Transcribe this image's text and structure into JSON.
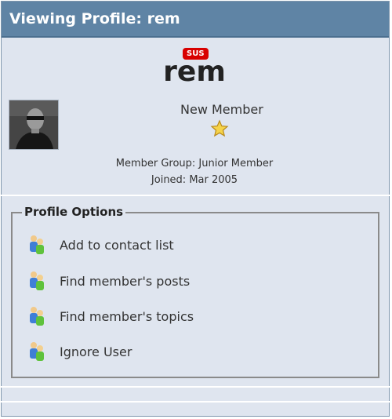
{
  "header": {
    "title": "Viewing Profile: rem"
  },
  "profile": {
    "badge": "SUS",
    "username": "rem",
    "rank": "New Member",
    "member_group": "Member Group: Junior Member",
    "joined": "Joined: Mar 2005"
  },
  "options": {
    "legend": "Profile Options",
    "items": [
      {
        "label": "Add to contact list"
      },
      {
        "label": "Find member's posts"
      },
      {
        "label": "Find member's topics"
      },
      {
        "label": "Ignore User"
      }
    ]
  },
  "colors": {
    "header": "#5f84a5",
    "panel": "#dfe5ef",
    "badge": "#d80000"
  }
}
